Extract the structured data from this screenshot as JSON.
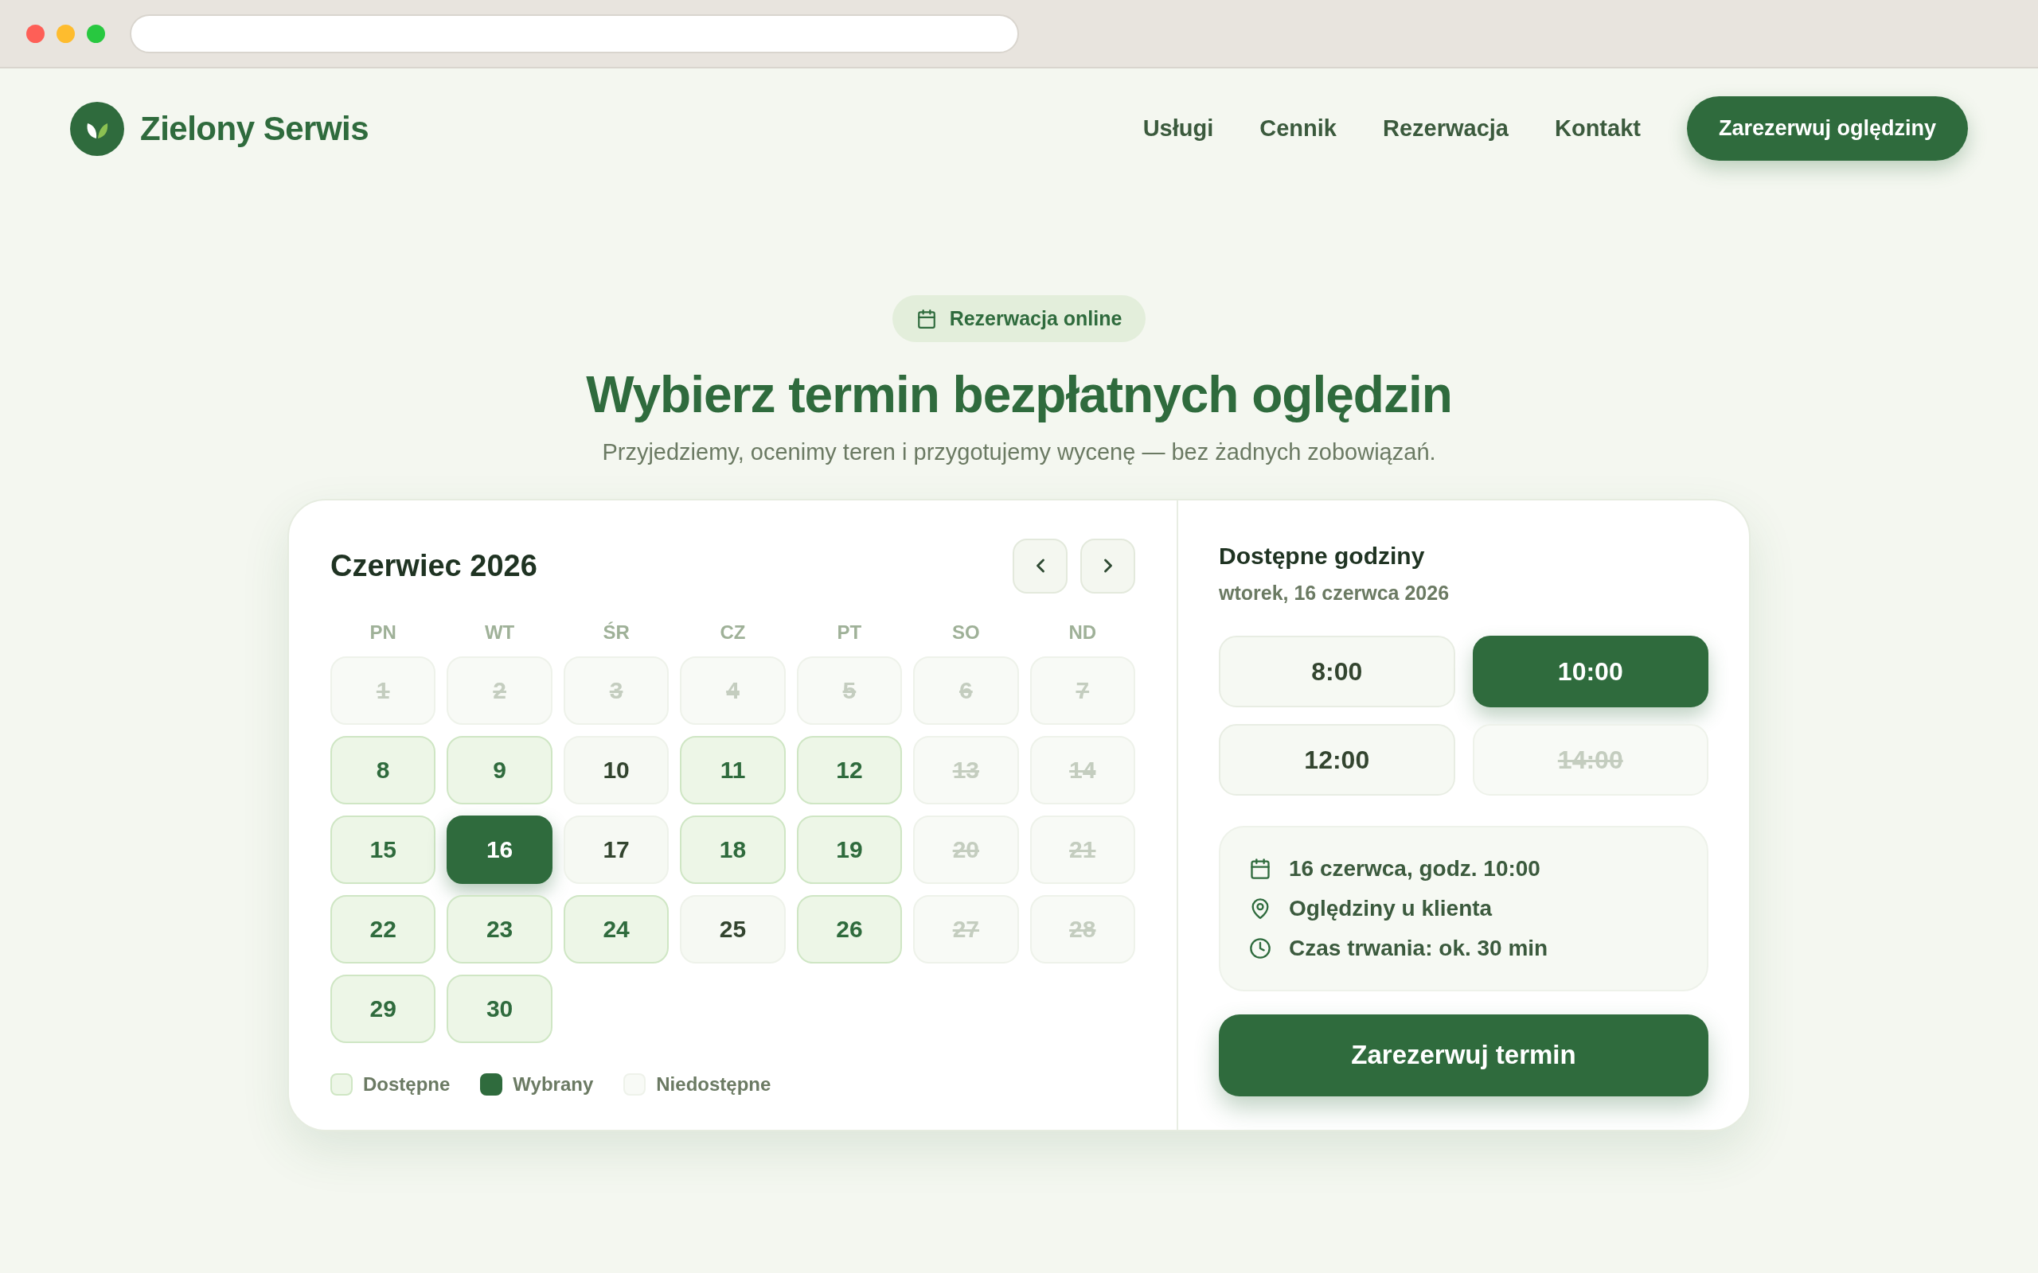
{
  "header": {
    "brand": "Zielony Serwis",
    "nav": [
      {
        "label": "Usługi"
      },
      {
        "label": "Cennik"
      },
      {
        "label": "Rezerwacja"
      },
      {
        "label": "Kontakt"
      }
    ],
    "cta": "Zarezerwuj oględziny"
  },
  "hero": {
    "badge": "Rezerwacja online",
    "title": "Wybierz termin bezpłatnych oględzin",
    "subtitle": "Przyjedziemy, ocenimy teren i przygotujemy wycenę — bez żadnych zobowiązań."
  },
  "calendar": {
    "month": "Czerwiec 2026",
    "weekdays": [
      "PN",
      "WT",
      "ŚR",
      "CZ",
      "PT",
      "SO",
      "ND"
    ],
    "days": [
      {
        "label": "1",
        "kind": "unavailable",
        "selected": false
      },
      {
        "label": "2",
        "kind": "unavailable",
        "selected": false
      },
      {
        "label": "3",
        "kind": "unavailable",
        "selected": false
      },
      {
        "label": "4",
        "kind": "unavailable",
        "selected": false
      },
      {
        "label": "5",
        "kind": "unavailable",
        "selected": false
      },
      {
        "label": "6",
        "kind": "unavailable",
        "selected": false
      },
      {
        "label": "7",
        "kind": "unavailable",
        "selected": false
      },
      {
        "label": "8",
        "kind": "available",
        "selected": false
      },
      {
        "label": "9",
        "kind": "available",
        "selected": false
      },
      {
        "label": "10",
        "kind": "regular",
        "selected": false
      },
      {
        "label": "11",
        "kind": "available",
        "selected": false
      },
      {
        "label": "12",
        "kind": "available",
        "selected": false
      },
      {
        "label": "13",
        "kind": "unavailable",
        "selected": false
      },
      {
        "label": "14",
        "kind": "unavailable",
        "selected": false
      },
      {
        "label": "15",
        "kind": "available",
        "selected": false
      },
      {
        "label": "16",
        "kind": "available",
        "selected": true
      },
      {
        "label": "17",
        "kind": "regular",
        "selected": false
      },
      {
        "label": "18",
        "kind": "available",
        "selected": false
      },
      {
        "label": "19",
        "kind": "available",
        "selected": false
      },
      {
        "label": "20",
        "kind": "unavailable",
        "selected": false
      },
      {
        "label": "21",
        "kind": "unavailable",
        "selected": false
      },
      {
        "label": "22",
        "kind": "available",
        "selected": false
      },
      {
        "label": "23",
        "kind": "available",
        "selected": false
      },
      {
        "label": "24",
        "kind": "available",
        "selected": false
      },
      {
        "label": "25",
        "kind": "regular",
        "selected": false
      },
      {
        "label": "26",
        "kind": "available",
        "selected": false
      },
      {
        "label": "27",
        "kind": "unavailable",
        "selected": false
      },
      {
        "label": "28",
        "kind": "unavailable",
        "selected": false
      },
      {
        "label": "29",
        "kind": "available",
        "selected": false
      },
      {
        "label": "30",
        "kind": "available",
        "selected": false
      }
    ],
    "legend": [
      {
        "label": "Dostępne",
        "kind": "available"
      },
      {
        "label": "Wybrany",
        "kind": "selected"
      },
      {
        "label": "Niedostępne",
        "kind": "unavailable"
      }
    ]
  },
  "booking": {
    "title": "Dostępne godziny",
    "date": "wtorek, 16 czerwca 2026",
    "slots": [
      {
        "label": "8:00",
        "selected": false,
        "disabled": false
      },
      {
        "label": "10:00",
        "selected": true,
        "disabled": false
      },
      {
        "label": "12:00",
        "selected": false,
        "disabled": false
      },
      {
        "label": "14:00",
        "selected": false,
        "disabled": true
      }
    ],
    "summary": [
      {
        "kind": "date",
        "text": "16 czerwca, godz. 10:00"
      },
      {
        "kind": "location",
        "text": "Oględziny u klienta"
      },
      {
        "kind": "duration",
        "text": "Czas trwania: ok. 30 min"
      }
    ],
    "submit": "Zarezerwuj termin"
  }
}
